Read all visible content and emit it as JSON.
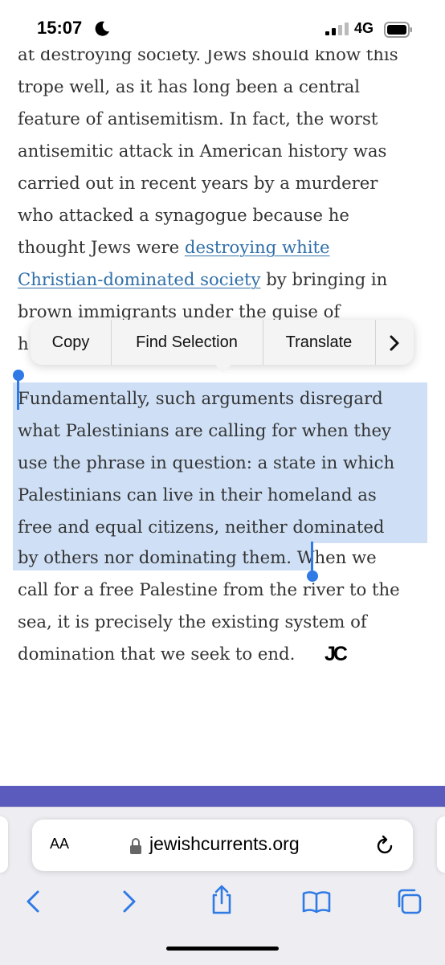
{
  "status": {
    "time": "15:07",
    "network": "4G"
  },
  "article": {
    "paragraph1_lines": [
      "at destroying society. Jews should know this",
      "trope well, as it has long been a central",
      "feature of antisemitism. In fact, the worst",
      "antisemitic attack in American history was",
      "carried out in recent years by a murderer",
      "who attacked a synagogue because he"
    ],
    "line7_before": "thought Jews were ",
    "link_line1": "destroying white",
    "link_line2": "Christian-dominated society",
    "line8_after": " by bringing in",
    "line9": "brown immigrants under the guise of",
    "line10_fragment": "h",
    "selected_lines": [
      "Fundamentally, such arguments disregard",
      "what Palestinians are calling for when they",
      "use the phrase in question: a state in which",
      "Palestinians can live in their homeland as",
      "free and equal citizens, neither dominated"
    ],
    "selected_last": "by others nor dominating them.",
    "after_selection": "When we",
    "closing_lines": [
      "call for a free Palestine from the river to the",
      "sea, it is precisely the existing system of"
    ],
    "final_line": "domination that we seek to end.",
    "end_mark": "JC"
  },
  "context_menu": {
    "copy": "Copy",
    "find_selection": "Find Selection",
    "translate": "Translate",
    "more_icon": "chevron-right-icon"
  },
  "browser": {
    "text_size_label": "AA",
    "url": "jewishcurrents.org",
    "lock_icon": "lock-icon",
    "reload_icon": "reload-icon",
    "nav_icons": [
      "back-icon",
      "forward-icon",
      "share-icon",
      "bookmarks-icon",
      "tabs-icon"
    ]
  },
  "colors": {
    "selection": "#cfe0f6",
    "selection_handle": "#2f7ae5",
    "link": "#2f6ea8",
    "site_band": "#5b5bbd",
    "toolbar_icons": "#2f7ae5"
  }
}
